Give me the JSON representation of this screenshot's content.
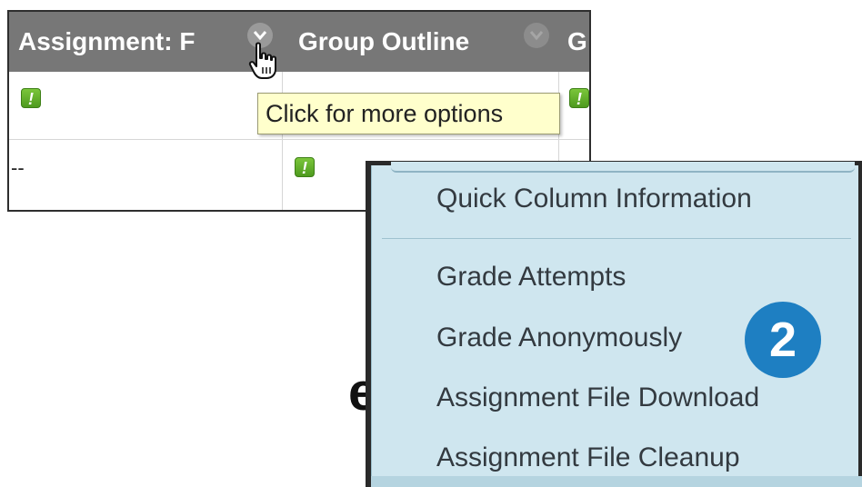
{
  "grade_center": {
    "columns": [
      {
        "title": "Assignment: F"
      },
      {
        "title": "Group Outline"
      },
      {
        "title": "G"
      }
    ],
    "rows": [
      {
        "cells": [
          "needs-grading",
          "",
          "needs-grading"
        ]
      },
      {
        "cells": [
          "--",
          "needs-grading",
          ""
        ]
      }
    ],
    "needs_grading_glyph": "!",
    "empty_grade": "--"
  },
  "tooltip": {
    "text": "Click for more options"
  },
  "column_menu": {
    "items": [
      "Quick Column Information",
      "Grade Attempts",
      "Grade Anonymously",
      "Assignment File Download",
      "Assignment File Cleanup"
    ]
  },
  "step_badge": "2",
  "background_fragment": "er",
  "colors": {
    "header_bg": "#777777",
    "menu_bg": "#cfe6ef",
    "badge_blue": "#1e7fc2",
    "needs_grading_green": "#5aa82a",
    "tooltip_bg": "#ffffcc"
  }
}
